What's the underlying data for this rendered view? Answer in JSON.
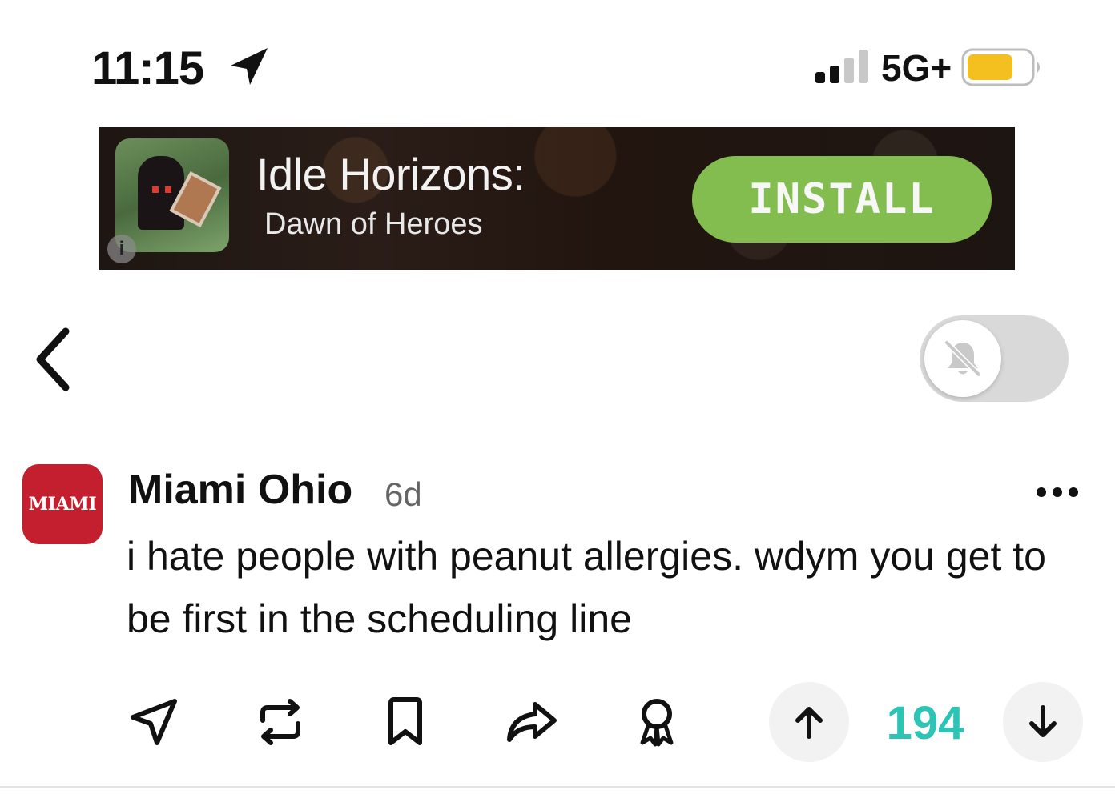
{
  "status_bar": {
    "time": "11:15",
    "network": "5G+",
    "location_icon": "location-arrow-icon",
    "signal_icon": "signal-bars-icon",
    "battery_icon": "battery-icon",
    "battery_color": "#f4c01f"
  },
  "ad": {
    "title": "Idle Horizons:",
    "subtitle": "Dawn of Heroes",
    "install_label": "INSTALL",
    "info_label": "i",
    "install_color": "#84bd4f"
  },
  "nav": {
    "back_icon": "chevron-left-icon",
    "notification_icon": "bell-off-icon",
    "notifications_enabled": false
  },
  "post": {
    "avatar_text": "MIAMI",
    "avatar_color": "#c41f2f",
    "author": "Miami Ohio",
    "age": "6d",
    "body": "i hate people with peanut allergies. wdym you get to be first in the scheduling line",
    "more_icon": "more-horizontal-icon"
  },
  "actions": {
    "items": [
      "send-icon",
      "repost-icon",
      "bookmark-icon",
      "share-icon",
      "award-icon"
    ],
    "vote_count": "194",
    "vote_color": "#2bc4b5",
    "upvote_icon": "arrow-up-icon",
    "downvote_icon": "arrow-down-icon"
  }
}
